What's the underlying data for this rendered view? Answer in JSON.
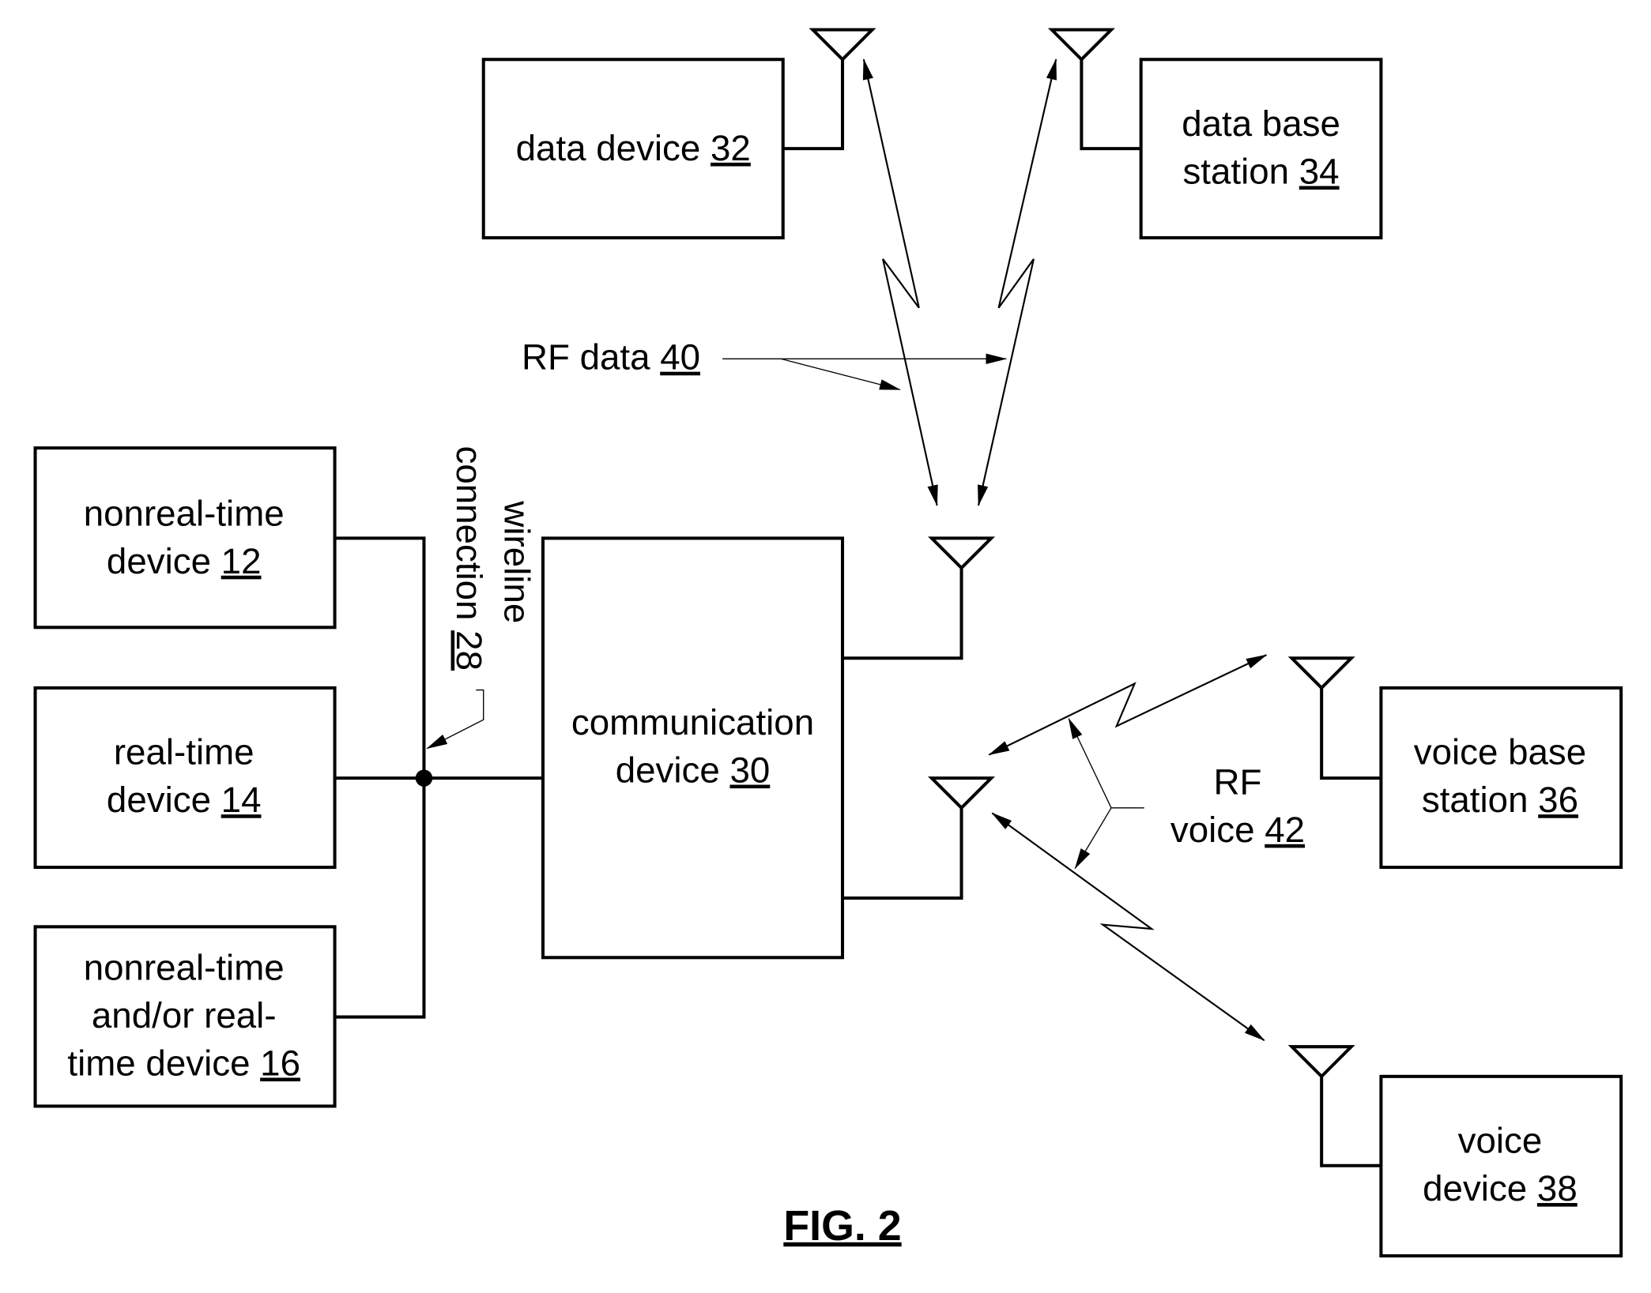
{
  "figure": {
    "label": "FIG. 2"
  },
  "blocks": {
    "data_device": {
      "line1_text": "data device ",
      "line1_num": "32"
    },
    "data_base_station": {
      "line1": "data base",
      "line2_text": "station ",
      "line2_num": "34"
    },
    "nonreal_time_device": {
      "line1": "nonreal-time",
      "line2_text": "device ",
      "line2_num": "12"
    },
    "real_time_device": {
      "line1": "real-time",
      "line2_text": "device ",
      "line2_num": "14"
    },
    "mixed_device": {
      "line1": "nonreal-time",
      "line2": "and/or real-",
      "line3_text": "time device ",
      "line3_num": "16"
    },
    "communication_device": {
      "line1": "communication",
      "line2_text": "device ",
      "line2_num": "30"
    },
    "voice_base_station": {
      "line1": "voice base",
      "line2_text": "station ",
      "line2_num": "36"
    },
    "voice_device": {
      "line1": "voice",
      "line2_text": "device ",
      "line2_num": "38"
    }
  },
  "labels": {
    "rf_data": {
      "text": "RF data ",
      "num": "40"
    },
    "rf_voice": {
      "line1": "RF",
      "line2_text": "voice ",
      "line2_num": "42"
    },
    "wireline": {
      "line1": "wireline",
      "line2_text": "connection ",
      "line2_num": "28"
    }
  }
}
